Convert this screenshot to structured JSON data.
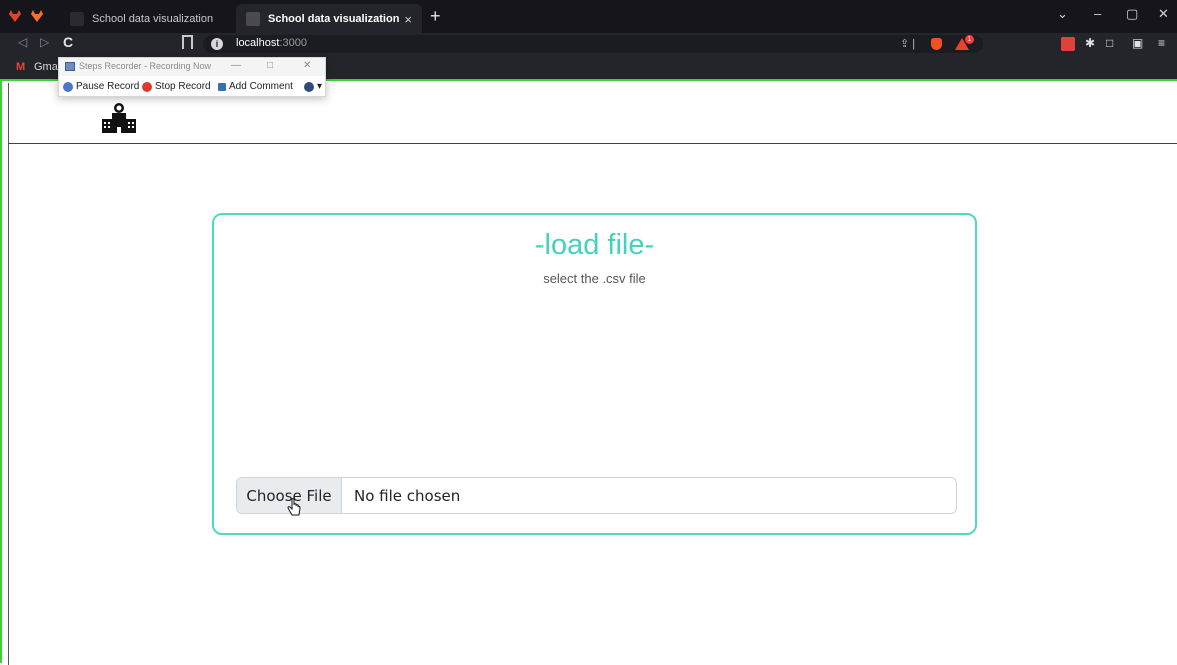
{
  "browser": {
    "tabs": [
      {
        "title": "School data visualization",
        "active": false
      },
      {
        "title": "School data visualization",
        "active": true
      }
    ],
    "new_tab": "+",
    "close_tab": "×",
    "window_controls": {
      "dropdown": "⌄",
      "minimize": "–",
      "restore": "▢",
      "close": "✕"
    },
    "url_host": "localhost",
    "url_port": ":3000",
    "bookmark_label": "Gmail",
    "shield_badge": "1"
  },
  "recorder": {
    "title": "Steps Recorder - Recording Now",
    "pause_label": "Pause Record",
    "stop_label": "Stop Record",
    "comment_label": "Add Comment",
    "help_label": "▾"
  },
  "card": {
    "title": "-load file-",
    "subtitle": "select the .csv file",
    "choose_label": "Choose File",
    "no_file_label": "No file chosen"
  },
  "colors": {
    "accent": "#41d3bd",
    "card_border": "#50d8c3",
    "recording_frame": "#3ad13a"
  }
}
